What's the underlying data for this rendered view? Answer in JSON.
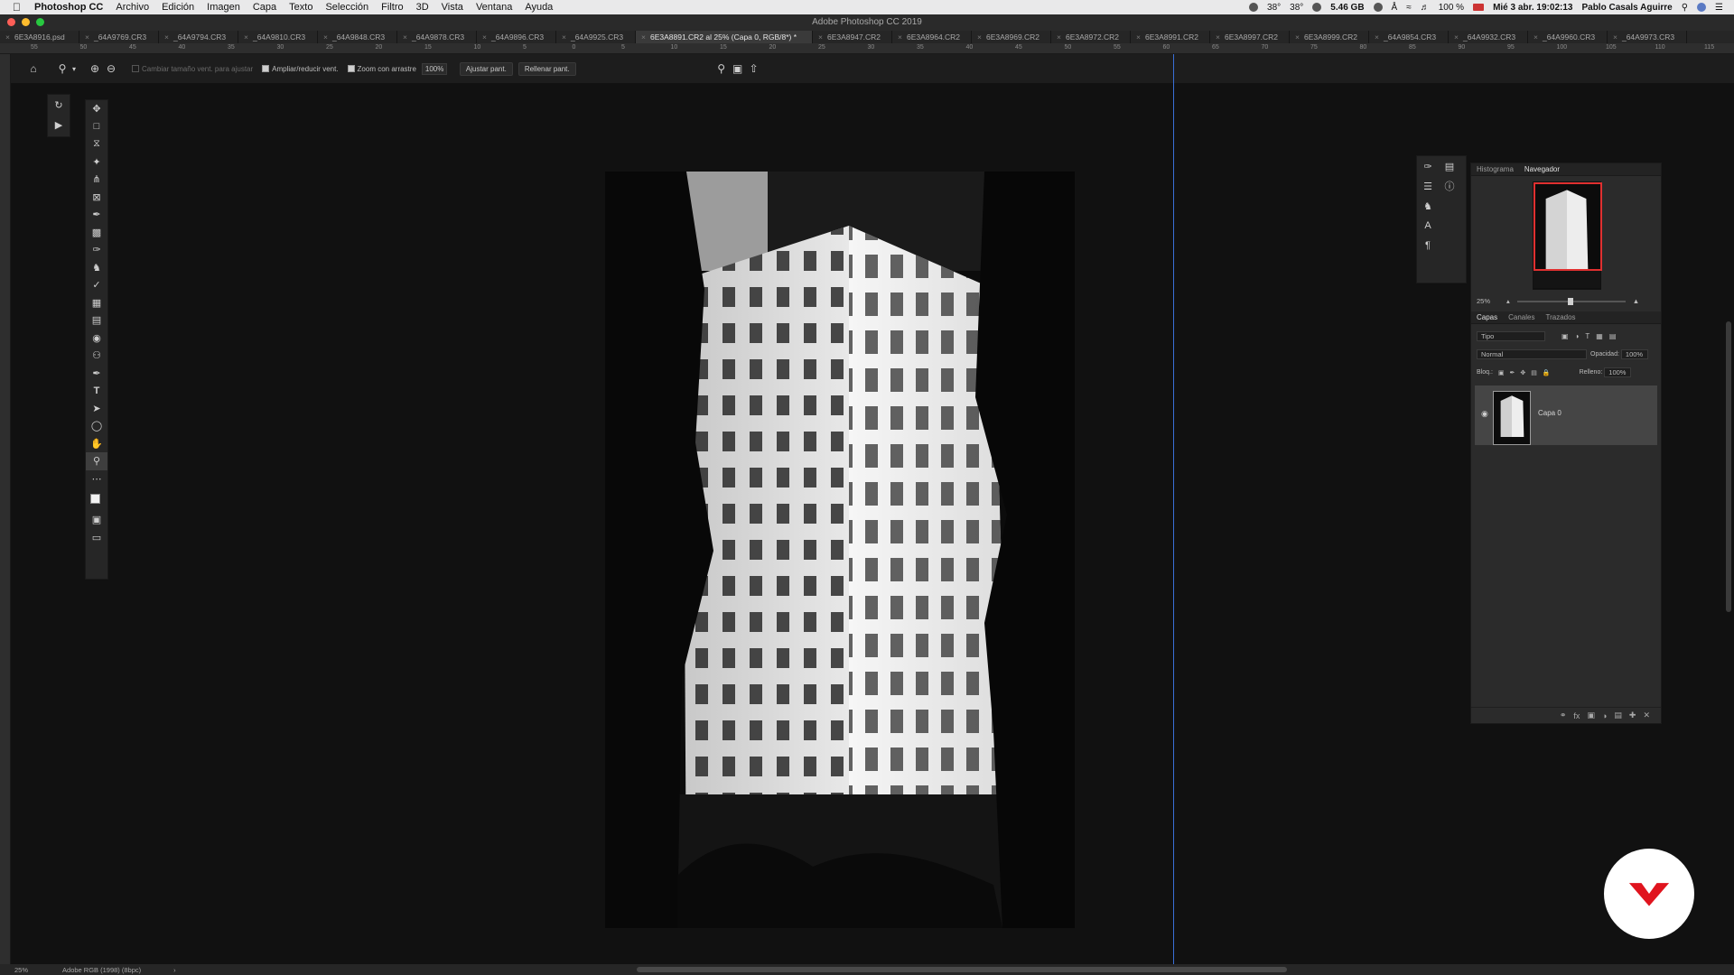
{
  "menubar": {
    "app_name": "Photoshop CC",
    "items": [
      "Archivo",
      "Edición",
      "Imagen",
      "Capa",
      "Texto",
      "Selección",
      "Filtro",
      "3D",
      "Vista",
      "Ventana",
      "Ayuda"
    ],
    "status": {
      "temp_1": "38°",
      "temp_2": "38°",
      "memory": "5.46 GB",
      "battery": "100 %",
      "datetime": "Mié 3 abr. 19:02:13",
      "user": "Pablo Casals Aguirre"
    }
  },
  "window": {
    "title": "Adobe Photoshop CC 2019"
  },
  "tabs": [
    "6E3A8916.psd",
    "_64A9769.CR3",
    "_64A9794.CR3",
    "_64A9810.CR3",
    "_64A9848.CR3",
    "_64A9878.CR3",
    "_64A9896.CR3",
    "_64A9925.CR3",
    "6E3A8891.CR2 al 25% (Capa 0, RGB/8*) *",
    "6E3A8947.CR2",
    "6E3A8964.CR2",
    "6E3A8969.CR2",
    "6E3A8972.CR2",
    "6E3A8991.CR2",
    "6E3A8997.CR2",
    "6E3A8999.CR2",
    "_64A9854.CR3",
    "_64A9932.CR3",
    "_64A9960.CR3",
    "_64A9973.CR3"
  ],
  "active_tab_index": 8,
  "ruler_labels": [
    "55",
    "50",
    "45",
    "40",
    "35",
    "30",
    "25",
    "20",
    "15",
    "10",
    "5",
    "0",
    "5",
    "10",
    "15",
    "20",
    "25",
    "30",
    "35",
    "40",
    "45",
    "50",
    "55",
    "60",
    "65",
    "70",
    "75",
    "80",
    "85",
    "90",
    "95",
    "100",
    "105",
    "110",
    "115"
  ],
  "options_bar": {
    "resize_window_label": "Cambiar tamaño vent. para ajustar",
    "zoom_all_label": "Ampliar/reducir vent.",
    "scrubby_zoom_label": "Zoom con arrastre",
    "zoom_value": "100%",
    "fit_screen_label": "Ajustar pant.",
    "fill_screen_label": "Rellenar pant."
  },
  "navigator": {
    "tabs": [
      "Histograma",
      "Navegador"
    ],
    "active": "Navegador",
    "zoom": "25%"
  },
  "layers": {
    "tabs": [
      "Capas",
      "Canales",
      "Trazados"
    ],
    "active": "Capas",
    "filter_kind": "Tipo",
    "blend_mode": "Normal",
    "opacity_label": "Opacidad:",
    "opacity_value": "100%",
    "lock_label": "Bloq.:",
    "fill_label": "Relleno:",
    "fill_value": "100%",
    "items": [
      {
        "name": "Capa 0",
        "visible": true
      }
    ]
  },
  "status_bar": {
    "zoom": "25%",
    "profile": "Adobe RGB (1998) (8bpc)"
  },
  "icons": {
    "home": "home-icon",
    "zoom": "zoom-icon",
    "zoom_in": "zoom-in-icon",
    "zoom_out": "zoom-out-icon",
    "search": "search-icon",
    "arrange": "arrange-icon",
    "share": "share-icon"
  },
  "colors": {
    "accent_blue": "#3a6fd8",
    "navigator_frame": "#e03030",
    "badge_red": "#e0141e"
  }
}
